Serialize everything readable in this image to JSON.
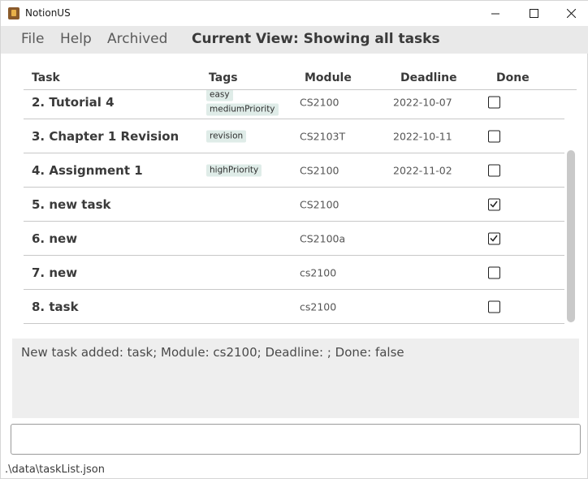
{
  "window": {
    "title": "NotionUS",
    "icon": "notionus-app-icon"
  },
  "menu": {
    "file": "File",
    "help": "Help",
    "archived": "Archived"
  },
  "view_title": "Current View: Showing all tasks",
  "table": {
    "columns": [
      "Task",
      "Tags",
      "Module",
      "Deadline",
      "Done"
    ],
    "rows": [
      {
        "task": "2. Tutorial 4",
        "tags": [
          "easy",
          "mediumPriority"
        ],
        "module": "CS2100",
        "deadline": "2022-10-07",
        "done": false
      },
      {
        "task": "3. Chapter 1 Revision",
        "tags": [
          "revision"
        ],
        "module": "CS2103T",
        "deadline": "2022-10-11",
        "done": false
      },
      {
        "task": "4. Assignment 1",
        "tags": [
          "highPriority"
        ],
        "module": "CS2100",
        "deadline": "2022-11-02",
        "done": false
      },
      {
        "task": "5. new task",
        "tags": [],
        "module": "CS2100",
        "deadline": "",
        "done": true
      },
      {
        "task": "6. new",
        "tags": [],
        "module": "CS2100a",
        "deadline": "",
        "done": true
      },
      {
        "task": "7. new",
        "tags": [],
        "module": "cs2100",
        "deadline": "",
        "done": false
      },
      {
        "task": "8. task",
        "tags": [],
        "module": "cs2100",
        "deadline": "",
        "done": false
      }
    ]
  },
  "result": "New task added: task; Module: cs2100; Deadline: ; Done: false",
  "command": {
    "value": "",
    "placeholder": ""
  },
  "status_bar": ".\\data\\taskList.json",
  "colors": {
    "menu_bg": "#e9e9e9",
    "result_bg": "#eeeeee",
    "tag_bg": "#dfece8",
    "scrollbar_thumb": "#c9c9c9"
  }
}
